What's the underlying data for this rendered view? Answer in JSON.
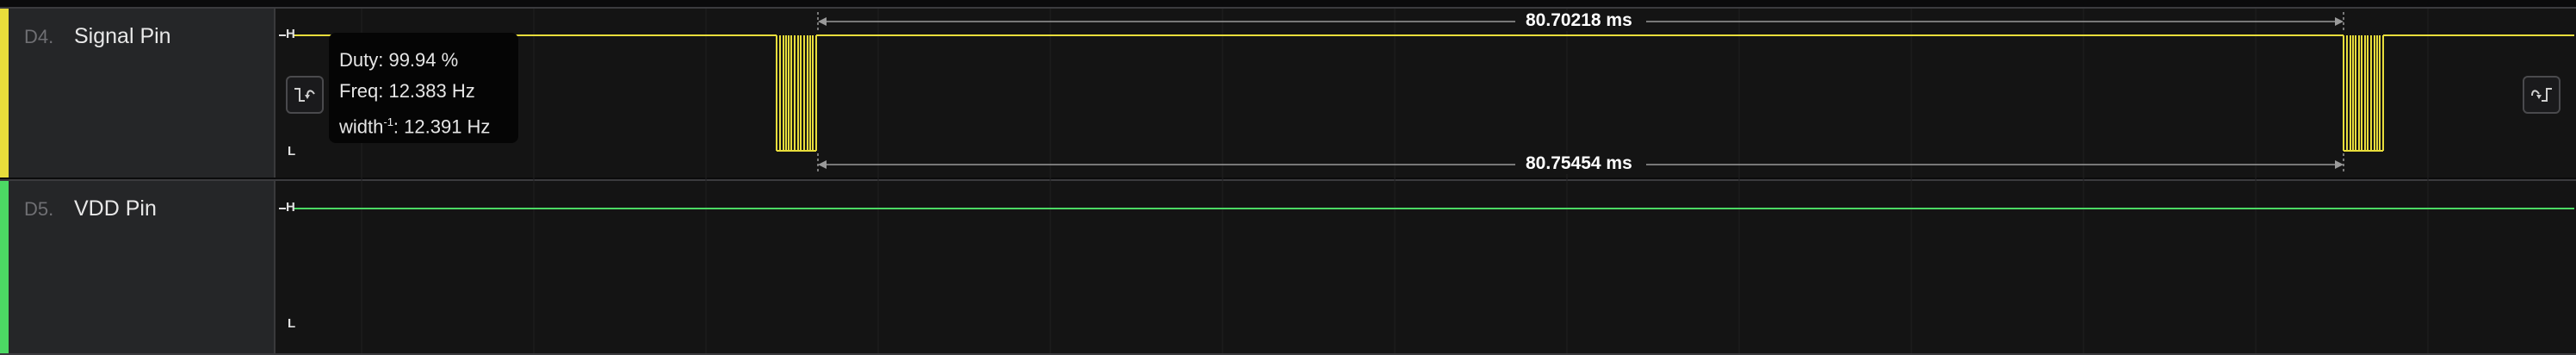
{
  "channels": [
    {
      "index": "D4.",
      "name": "Signal Pin",
      "color": "#e8dd3b",
      "high_label": "H",
      "low_label": "L"
    },
    {
      "index": "D5.",
      "name": "VDD Pin",
      "color": "#4cd964",
      "high_label": "H",
      "low_label": "L"
    }
  ],
  "measurement_tooltip": {
    "duty": "Duty: 99.94 %",
    "freq": "Freq: 12.383 Hz",
    "width_prefix": "width",
    "width_sup": "-1",
    "width_value": ": 12.391 Hz"
  },
  "measurements": {
    "top_interval": "80.70218 ms",
    "bottom_interval": "80.75454 ms"
  },
  "icons": {
    "prev_edge": "previous-edge-icon",
    "next_edge": "next-edge-icon"
  }
}
